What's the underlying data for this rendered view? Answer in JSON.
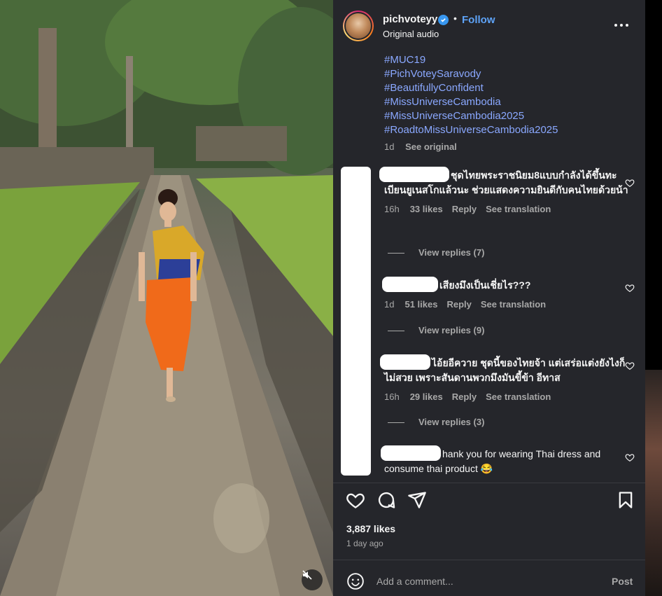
{
  "post": {
    "username": "pichvoteyy",
    "follow_label": "Follow",
    "separator": "•",
    "audio": "Original audio",
    "hashtags": [
      "#MUC19",
      "#PichVoteySaravody",
      "#BeautifullyConfident",
      "#MissUniverseCambodia",
      "#MissUniverseCambodia2025",
      "#RoadtoMissUniverseCambodia2025"
    ],
    "caption_time": "1d",
    "see_original": "See original"
  },
  "comments": [
    {
      "text": "ชุดไทยพระราชนิยม8แบบกำลังได้ขึ้นทะเบียนยูเนสโกแล้วนะ ช่วยแสดงความยินดีกับคนไทยด้วยน้า",
      "time": "16h",
      "likes": "33 likes",
      "reply": "Reply",
      "translate": "See translation",
      "replies": "View replies (7)"
    },
    {
      "text": "เสียงมึงเป็นเชี่ยไร???",
      "time": "1d",
      "likes": "51 likes",
      "reply": "Reply",
      "translate": "See translation",
      "replies": "View replies (9)"
    },
    {
      "text": "ไอ้ยอีควาย ชุดนี้ของไทยจ้า แต่เสร่อแต่งยังไงก็ไม่สวย เพราะสันดานพวกมึงมันขี้ข้า อีทาส",
      "time": "16h",
      "likes": "29 likes",
      "reply": "Reply",
      "translate": "See translation",
      "replies": "View replies (3)"
    },
    {
      "text": "hank you for wearing Thai dress and consume thai product 😂"
    }
  ],
  "footer": {
    "likes": "3,887 likes",
    "time_ago": "1 day ago",
    "comment_placeholder": "Add a comment...",
    "post_label": "Post"
  },
  "icons": {
    "like": "heart-icon",
    "comment": "comment-icon",
    "share": "share-icon",
    "save": "bookmark-icon",
    "emoji": "emoji-icon",
    "mute": "muted-speaker-icon",
    "more": "more-options-icon",
    "verified": "verified-badge-icon"
  },
  "colors": {
    "panel_bg": "#25262b",
    "link_blue": "#5ea3f7",
    "hashtag": "#8aa8ff",
    "muted_text": "#a8a8a8"
  }
}
